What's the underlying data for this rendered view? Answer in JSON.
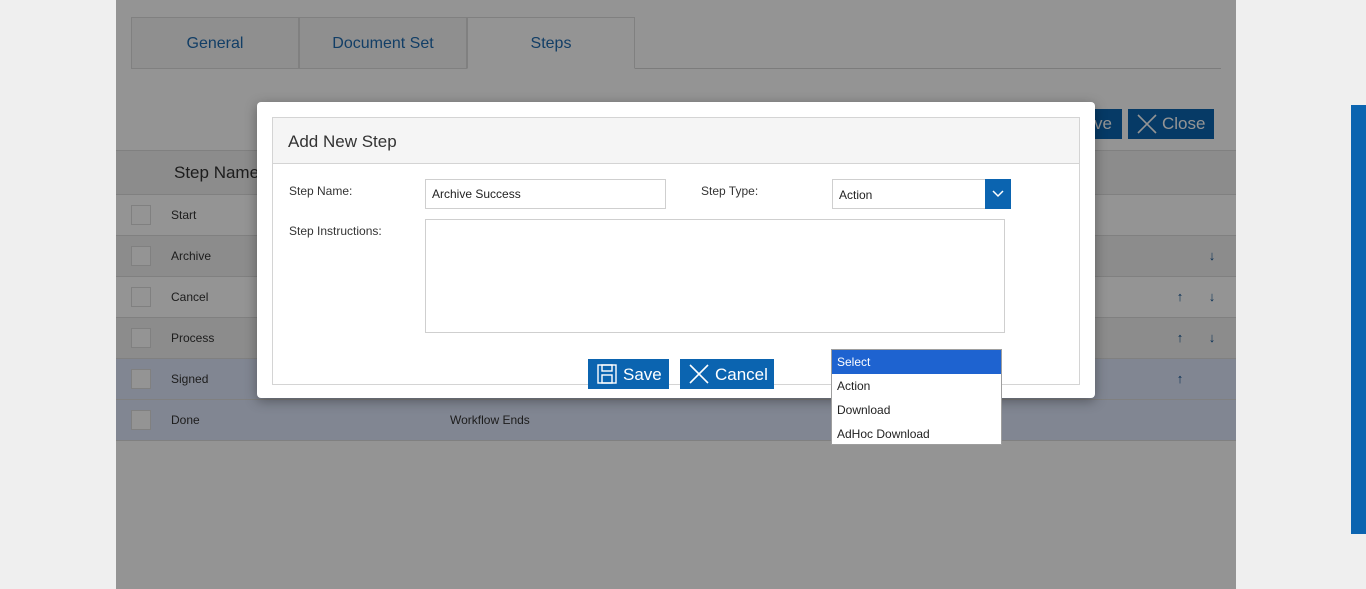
{
  "tabs": [
    "General",
    "Document Set",
    "Steps"
  ],
  "toolbar": {
    "save_partial": "ve",
    "close_label": "Close"
  },
  "grid": {
    "header": "Step Name",
    "rows": [
      {
        "name": "Start",
        "desc": ""
      },
      {
        "name": "Archive",
        "desc": ""
      },
      {
        "name": "Cancel",
        "desc": ""
      },
      {
        "name": "Process",
        "desc": ""
      },
      {
        "name": "Signed",
        "desc": ""
      },
      {
        "name": "Done",
        "desc": "Workflow Ends"
      }
    ]
  },
  "modal": {
    "title": "Add New Step",
    "step_name_label": "Step Name:",
    "step_name_value": "Archive Success",
    "step_type_label": "Step Type:",
    "step_type_value": "Action",
    "instructions_label": "Step Instructions:",
    "instructions_value": "",
    "save_label": "Save",
    "cancel_label": "Cancel"
  },
  "dropdown": {
    "options": [
      "Select",
      "Action",
      "Download",
      "AdHoc Download"
    ],
    "highlighted": "Select"
  },
  "colors": {
    "accent": "#0b64b0",
    "highlight": "#1e63d0"
  }
}
